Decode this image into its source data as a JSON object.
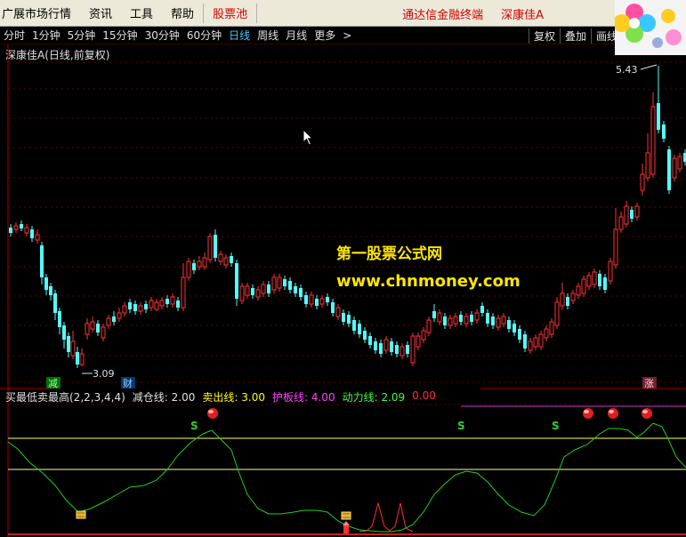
{
  "menubar": {
    "items": [
      "广展市场行情",
      "资讯",
      "工具",
      "帮助"
    ],
    "highlight": "股票池",
    "right_label1": "通达信金融终端",
    "right_label2": "深康佳A"
  },
  "periodbar": {
    "periods": [
      "分时",
      "1分钟",
      "5分钟",
      "15分钟",
      "30分钟",
      "60分钟",
      "日线",
      "周线",
      "月线",
      "更多"
    ],
    "active": "日线",
    "more_arrow": ">",
    "tools": [
      "复权",
      "叠加",
      "画线"
    ]
  },
  "stock_title": "深康佳A(日线,前复权)",
  "watermark": {
    "line1": "第一股票公式网",
    "line2": "www.chnmoney.com"
  },
  "price_labels": {
    "high": "5.43",
    "low": "3.09"
  },
  "marks": {
    "jian": "减",
    "cai": "财",
    "zhang": "涨",
    "s": "S"
  },
  "indicator": {
    "name": "买最低卖最高(2,2,3,4,4)",
    "items": [
      {
        "label": "减仓线:",
        "value": "2.00",
        "color": "#e0e0e0"
      },
      {
        "label": "卖出线:",
        "value": "3.00",
        "color": "#ffff00"
      },
      {
        "label": "护板线:",
        "value": "4.00",
        "color": "#ff40ff"
      },
      {
        "label": "动力线:",
        "value": "2.09",
        "color": "#40ff40"
      },
      {
        "label": "",
        "value": "0.00",
        "color": "#ff3030"
      }
    ]
  },
  "colors": {
    "up": "#ff3232",
    "down": "#54fcfc",
    "dynamic": "#1fd01f",
    "level": "#ffff66"
  }
}
